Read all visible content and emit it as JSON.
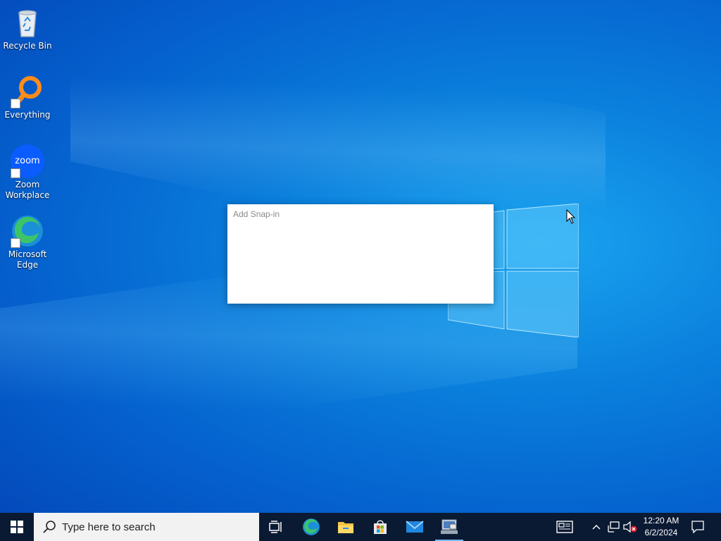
{
  "desktop": {
    "icons": [
      {
        "label": "Recycle Bin",
        "icon": "recycle-bin-icon"
      },
      {
        "label": "Everything",
        "icon": "everything-search-icon"
      },
      {
        "label": "Zoom Workplace",
        "icon": "zoom-icon",
        "glyph_text": "zoom"
      },
      {
        "label": "Microsoft Edge",
        "icon": "edge-icon"
      }
    ]
  },
  "dialog": {
    "title": "Add Snap-in"
  },
  "taskbar": {
    "search_placeholder": "Type here to search",
    "apps": [
      "task-view-icon",
      "edge-icon",
      "file-explorer-icon",
      "microsoft-store-icon",
      "mail-icon",
      "mmc-console-icon"
    ],
    "clock": {
      "time": "12:20 AM",
      "date": "6/2/2024"
    }
  },
  "colors": {
    "accent": "#0078d7",
    "taskbar": "#0b1a33",
    "search_bg": "#f2f2f2"
  }
}
